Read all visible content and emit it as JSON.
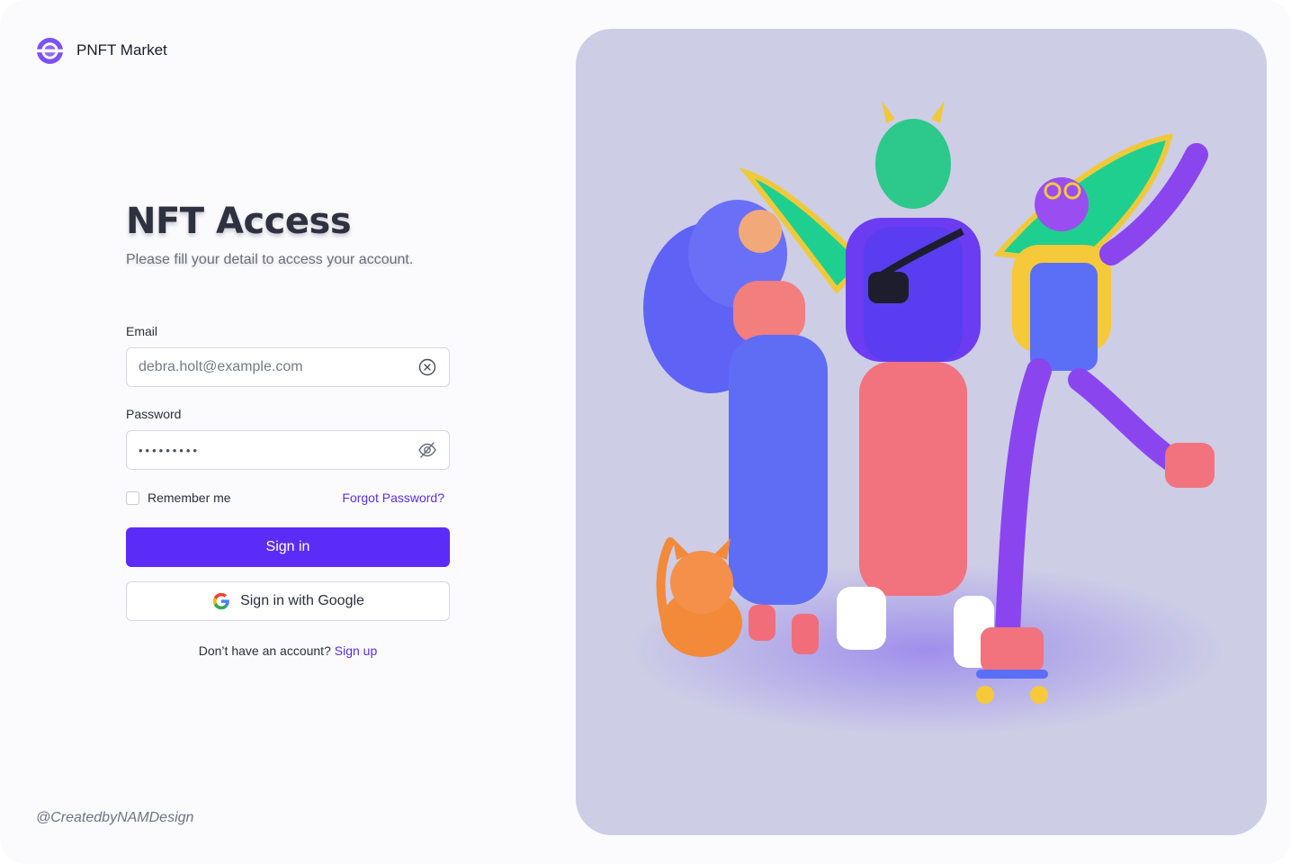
{
  "brand": {
    "name": "PNFT Market",
    "logo": "ring-logo"
  },
  "login": {
    "title": "NFT Access",
    "subtitle": "Please fill your detail to access your account.",
    "email": {
      "label": "Email",
      "value": "debra.holt@example.com",
      "clear_icon": "clear-circle-icon"
    },
    "password": {
      "label": "Password",
      "value": "•••••••••",
      "toggle_icon": "eye-off-icon"
    },
    "remember_label": "Remember me",
    "forgot_label": "Forgot Password?",
    "sign_in_label": "Sign in",
    "google_label": "Sign in with Google",
    "signup_prompt": "Don’t have an account?",
    "signup_link": "Sign up"
  },
  "credit": "@CreatedbyNAMDesign",
  "colors": {
    "accent": "#5b2cf7",
    "hero_background": "#cdcde6",
    "text_dark": "#2c2f3a"
  }
}
